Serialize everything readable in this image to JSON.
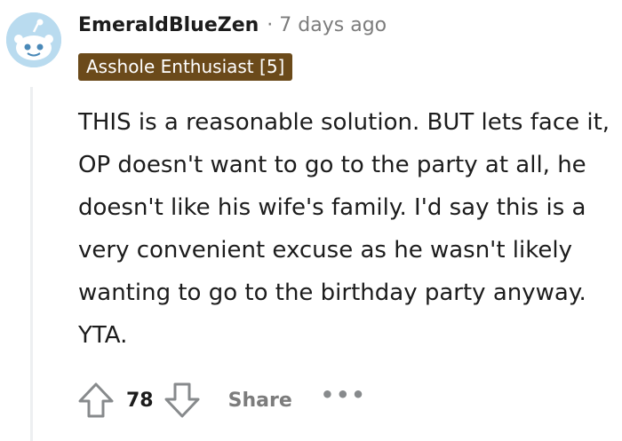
{
  "comment": {
    "username": "EmeraldBlueZen",
    "separator": "·",
    "timestamp": "7 days ago",
    "flair": "Asshole Enthusiast [5]",
    "body": "THIS is a reasonable solution. BUT lets face it, OP doesn't want to go to the party at all, he doesn't like his wife's family. I'd say this is a very convenient excuse as he wasn't likely wanting to go to the birthday party anyway. YTA.",
    "score": "78"
  },
  "actions": {
    "share_label": "Share",
    "more_label": "•••"
  },
  "icons": {
    "avatar": "snoo-avatar-icon",
    "upvote": "upvote-arrow-icon",
    "downvote": "downvote-arrow-icon",
    "more": "more-options-icon"
  },
  "colors": {
    "flair_bg": "#6b4a1a",
    "avatar_bg": "#b9dbef",
    "muted_text": "#7c7c7c"
  }
}
